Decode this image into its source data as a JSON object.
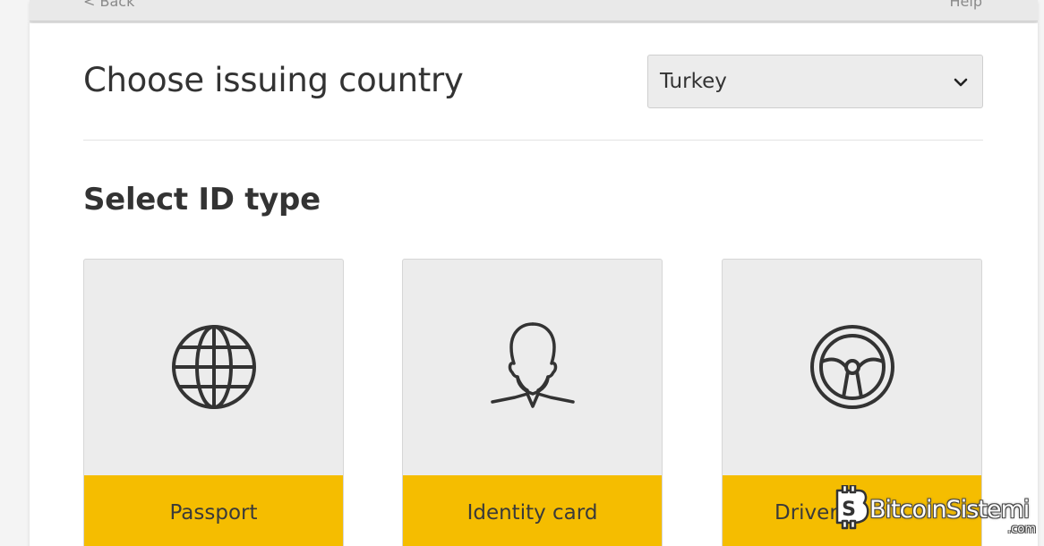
{
  "nav": {
    "back_label": "< Back",
    "help_label": "Help"
  },
  "country": {
    "heading": "Choose issuing country",
    "selected": "Turkey"
  },
  "id_type": {
    "heading": "Select ID type",
    "options": [
      {
        "label": "Passport",
        "icon": "globe-icon"
      },
      {
        "label": "Identity card",
        "icon": "person-icon"
      },
      {
        "label": "Drivers",
        "icon": "steering-wheel-icon"
      }
    ]
  },
  "watermark": {
    "name": "BitcoinSistemi",
    "tld": ".com"
  },
  "colors": {
    "accent": "#f5bd00",
    "option_bg": "#ececec",
    "text": "#333333"
  }
}
